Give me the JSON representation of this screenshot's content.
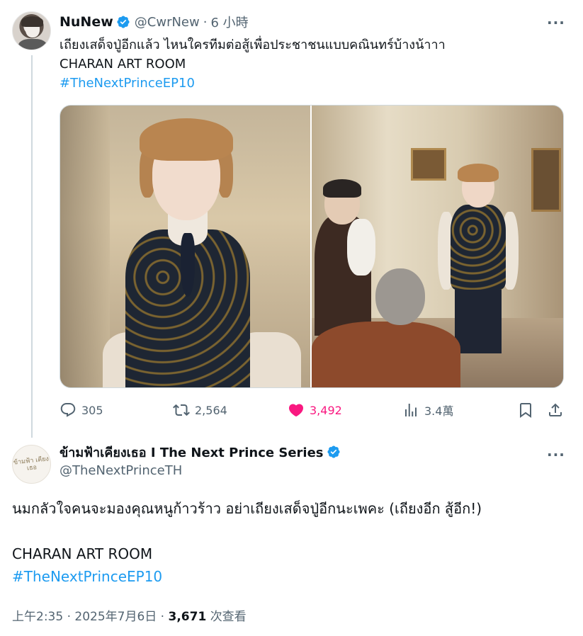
{
  "tweet1": {
    "name": "NuNew",
    "handle": "@CwrNew",
    "separator": "·",
    "time": "6 小時",
    "more": "···",
    "lines": [
      "เถียงเสด็จปู่อีกแล้ว ไหนใครทีมต่อสู้เพื่อประชาชนแบบคณินทร์บ้างน้าาา",
      "CHARAN ART ROOM"
    ],
    "hashtag": "#TheNextPrinceEP10",
    "actions": {
      "replies": "305",
      "reposts": "2,564",
      "likes": "3,492",
      "views": "3.4萬"
    },
    "icons": [
      "verified-icon",
      "reply-icon",
      "repost-icon",
      "like-icon",
      "views-icon",
      "bookmark-icon",
      "share-icon"
    ],
    "colors": {
      "accent": "#1d9bf0",
      "like": "#f91880",
      "muted": "#536471"
    }
  },
  "tweet2": {
    "name": "ข้ามฟ้าเคียงเธอ I The Next Prince Series",
    "handle": "@TheNextPrinceTH",
    "more": "···",
    "avatar_logo": "ข้ามฟ้า เคียงเธอ",
    "lines": [
      "นมกลัวใจคนจะมองคุณหนูก้าวร้าว อย่าเถียงเสด็จปู่อีกนะเพคะ (เถียงอีก สู้อีก!)",
      "",
      "CHARAN ART ROOM"
    ],
    "hashtag": "#TheNextPrinceEP10",
    "meta": {
      "timestamp": "上午2:35 · 2025年7月6日 ·",
      "views": "3,671",
      "views_label": "次查看"
    }
  }
}
